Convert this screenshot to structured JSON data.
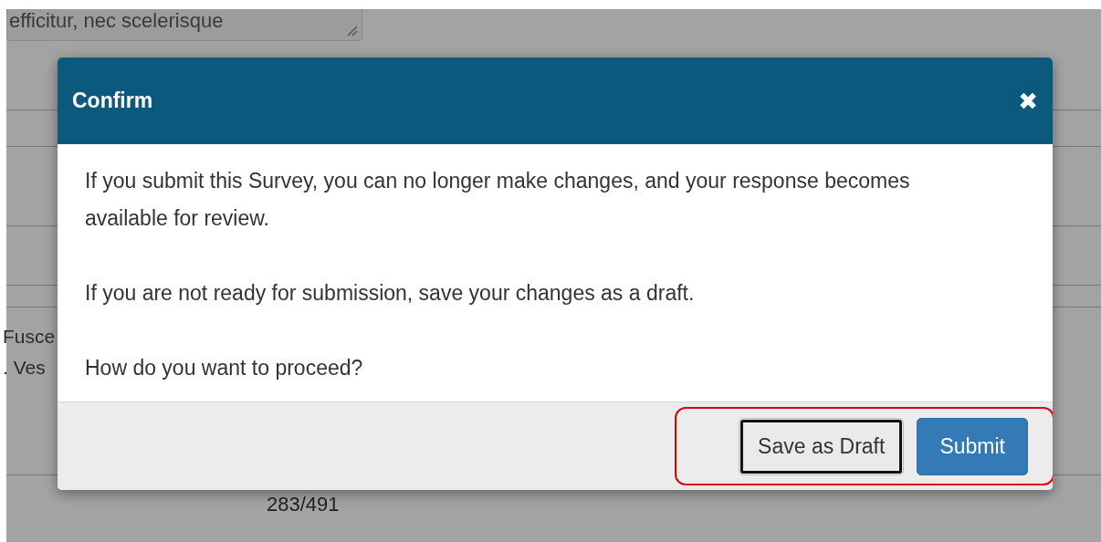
{
  "background": {
    "textarea_text": "efficitur, nec scelerisque",
    "counter_bottom": "283/491",
    "fragments": [
      "Fusce",
      ". Ves"
    ]
  },
  "dialog": {
    "title": "Confirm",
    "close": "✖",
    "paragraphs": [
      "If you submit this Survey, you can no longer make changes, and your response becomes available for review.",
      "If you are not ready for submission, save your changes as a draft.",
      "How do you want to proceed?"
    ],
    "buttons": [
      {
        "label": "Save as Draft",
        "kind": "secondary",
        "focused": true
      },
      {
        "label": "Submit",
        "kind": "primary",
        "focused": false
      }
    ],
    "highlight": true
  }
}
